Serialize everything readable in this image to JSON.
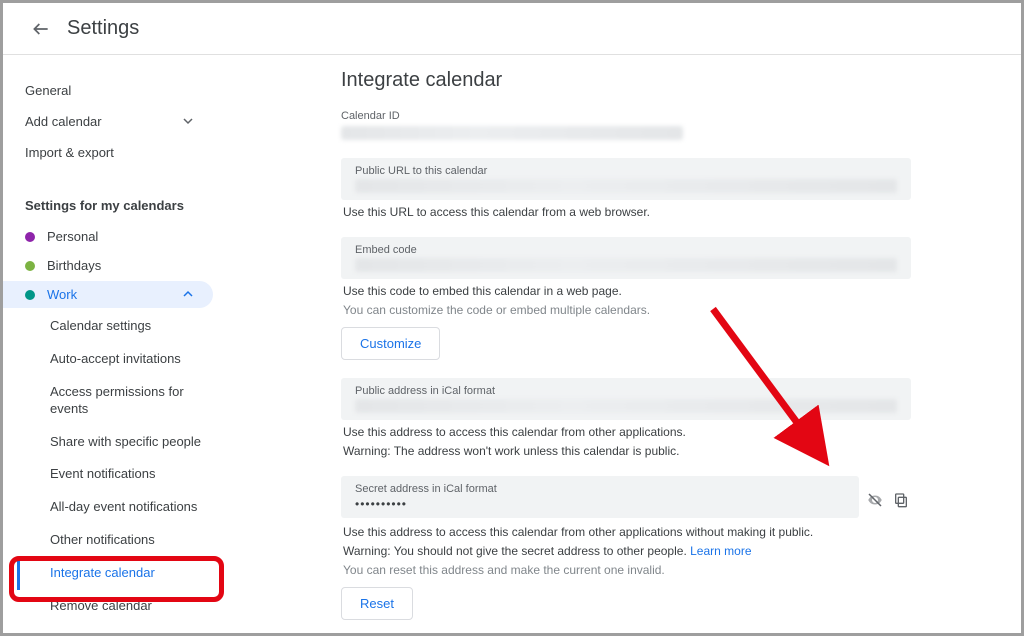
{
  "header": {
    "title": "Settings"
  },
  "sidebar": {
    "general": "General",
    "add_calendar": "Add calendar",
    "import_export": "Import & export",
    "my_cals_head": "Settings for my calendars",
    "calendars": [
      {
        "name": "Personal",
        "color": "#8e24aa"
      },
      {
        "name": "Birthdays",
        "color": "#7cb342"
      },
      {
        "name": "Work",
        "color": "#009688"
      }
    ],
    "work_subs": [
      "Calendar settings",
      "Auto-accept invitations",
      "Access permissions for events",
      "Share with specific people",
      "Event notifications",
      "All-day event notifications",
      "Other notifications",
      "Integrate calendar",
      "Remove calendar"
    ]
  },
  "main": {
    "heading": "Integrate calendar",
    "calendar_id_label": "Calendar ID",
    "public_url_label": "Public URL to this calendar",
    "public_url_helper": "Use this URL to access this calendar from a web browser.",
    "embed_label": "Embed code",
    "embed_helper1": "Use this code to embed this calendar in a web page.",
    "embed_helper2": "You can customize the code or embed multiple calendars.",
    "customize_btn": "Customize",
    "ical_public_label": "Public address in iCal format",
    "ical_public_helper1": "Use this address to access this calendar from other applications.",
    "ical_public_helper2": "Warning: The address won't work unless this calendar is public.",
    "ical_secret_label": "Secret address in iCal format",
    "ical_secret_value": "••••••••••",
    "ical_secret_helper1": "Use this address to access this calendar from other applications without making it public.",
    "ical_secret_helper2a": "Warning: You should not give the secret address to other people. ",
    "ical_secret_learn": "Learn more",
    "ical_secret_helper3": "You can reset this address and make the current one invalid.",
    "reset_btn": "Reset"
  }
}
